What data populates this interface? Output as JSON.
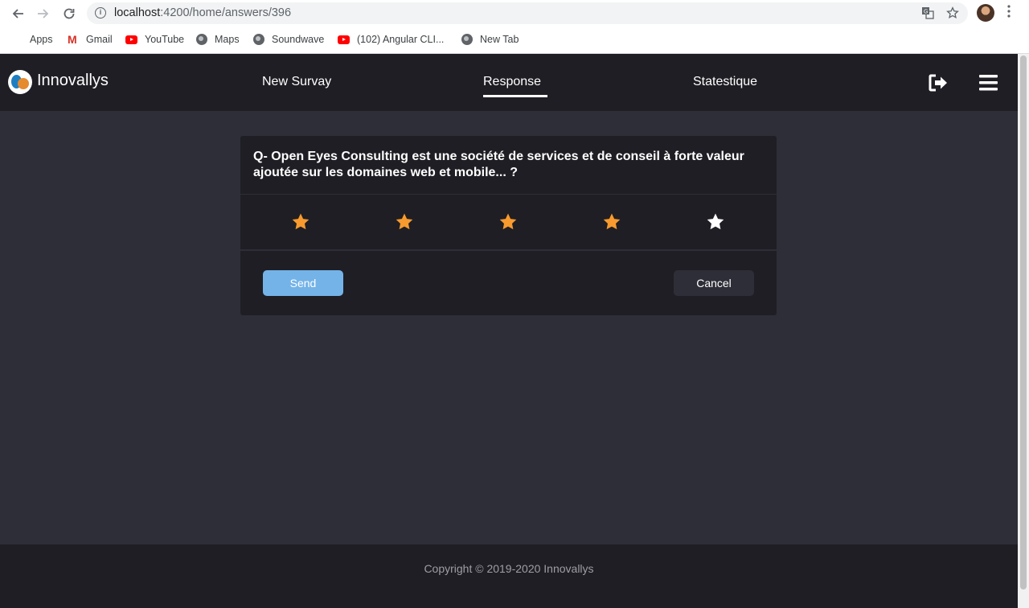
{
  "browser": {
    "url_host": "localhost",
    "url_path": ":4200/home/answers/396",
    "bookmarks": [
      {
        "label": "Apps",
        "icon": "apps-grid-icon"
      },
      {
        "label": "Gmail",
        "icon": "gmail-icon"
      },
      {
        "label": "YouTube",
        "icon": "youtube-icon"
      },
      {
        "label": "Maps",
        "icon": "globe-icon"
      },
      {
        "label": "Soundwave",
        "icon": "globe-icon"
      },
      {
        "label": "(102) Angular CLI...",
        "icon": "youtube-icon"
      },
      {
        "label": "New Tab",
        "icon": "globe-icon"
      }
    ]
  },
  "header": {
    "brand": "Innovallys",
    "nav": [
      {
        "label": "New Survay",
        "active": false
      },
      {
        "label": "Response",
        "active": true
      },
      {
        "label": "Statestique",
        "active": false
      }
    ],
    "icons": [
      "logout-icon",
      "menu-icon"
    ]
  },
  "survey": {
    "question": "Q- Open Eyes Consulting est une société de services et de conseil à forte valeur ajoutée sur les domaines web et mobile... ?",
    "rating": {
      "value": 4,
      "max": 5
    },
    "colors": {
      "star_filled": "#f89a2e",
      "star_empty": "#ffffff"
    },
    "send_label": "Send",
    "cancel_label": "Cancel"
  },
  "footer": {
    "copyright": "Copyright © 2019-2020 Innovallys"
  },
  "colors": {
    "header_bg": "#1f1e24",
    "page_bg": "#2e2e38",
    "send_bg": "#74b3e8"
  }
}
